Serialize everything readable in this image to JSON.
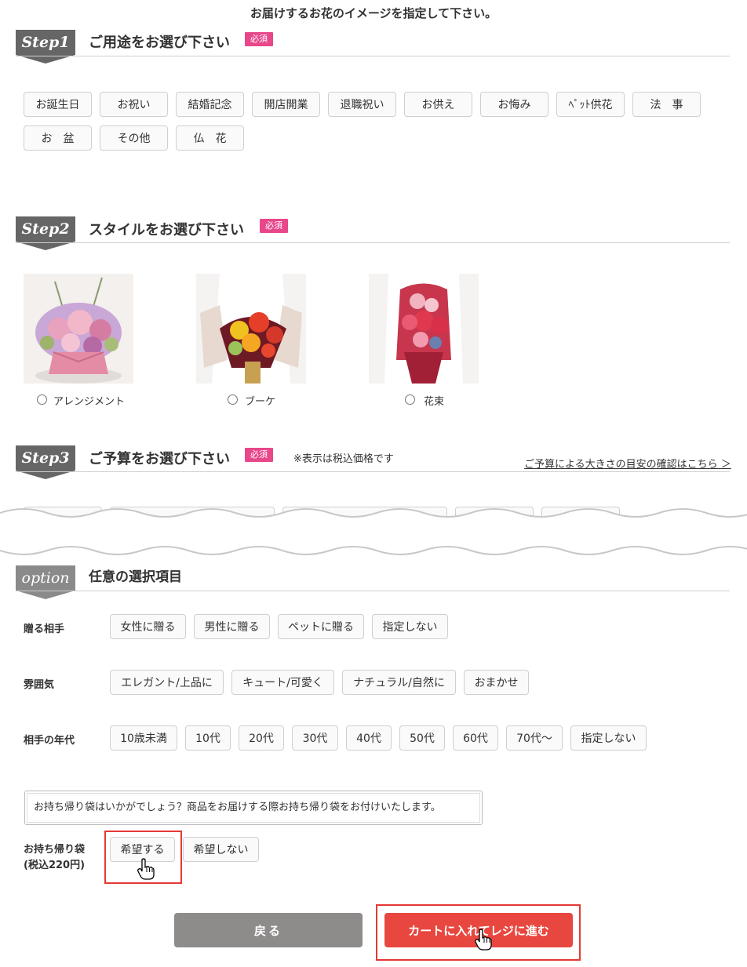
{
  "page_title": "お届けするお花のイメージを指定して下さい。",
  "required_label": "必須",
  "step1": {
    "badge": "Step1",
    "title": "ご用途をお選び下さい",
    "chips": [
      "お誕生日",
      "お祝い",
      "結婚記念",
      "開店開業",
      "退職祝い",
      "お供え",
      "お悔み",
      "ﾍﾟｯﾄ供花",
      "法　事",
      "お　盆",
      "その他",
      "仏　花"
    ]
  },
  "step2": {
    "badge": "Step2",
    "title": "スタイルをお選び下さい",
    "options": [
      {
        "label": "アレンジメント",
        "photo": "arrangement-photo"
      },
      {
        "label": "ブーケ",
        "photo": "bouquet-photo"
      },
      {
        "label": "花束",
        "photo": "hanataba-photo"
      }
    ]
  },
  "step3": {
    "badge": "Step3",
    "title": "ご予算をお選び下さい",
    "note": "※表示は税込価格です",
    "link": "ご予算による大きさの目安の確認はこちら ＞"
  },
  "option": {
    "badge": "option",
    "title": "任意の選択項目",
    "recipient": {
      "label": "贈る相手",
      "chips": [
        "女性に贈る",
        "男性に贈る",
        "ペットに贈る",
        "指定しない"
      ]
    },
    "mood": {
      "label": "雰囲気",
      "chips": [
        "エレガント/上品に",
        "キュート/可愛く",
        "ナチュラル/自然に",
        "おまかせ"
      ]
    },
    "age": {
      "label": "相手の年代",
      "chips": [
        "10歳未満",
        "10代",
        "20代",
        "30代",
        "40代",
        "50代",
        "60代",
        "70代～",
        "指定しない"
      ]
    },
    "bag_message": "お持ち帰り袋はいかがでしょう？商品をお届けする際お持ち帰り袋をお付けいたします。",
    "bag": {
      "label_line1": "お持ち帰り袋",
      "label_line2": "(税込220円)",
      "chips": [
        "希望する",
        "希望しない"
      ]
    }
  },
  "buttons": {
    "back": "戻る",
    "cart": "カートに入れてレジに進む"
  },
  "colors": {
    "required": "#e8478a",
    "cart_button": "#e8473f",
    "back_button": "#8e8b8b",
    "highlight_box": "#e53935"
  }
}
